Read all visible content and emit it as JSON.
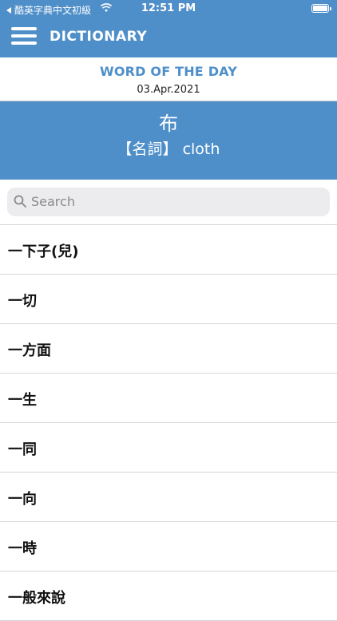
{
  "status_bar": {
    "back_app": "酷英字典中文初級",
    "time": "12:51 PM"
  },
  "nav": {
    "title": "DICTIONARY"
  },
  "word_of_the_day": {
    "heading": "WORD OF THE DAY",
    "date": "03.Apr.2021",
    "word": "布",
    "definition": "【名詞】 cloth"
  },
  "search": {
    "placeholder": "Search"
  },
  "entries": [
    "一下子(兒)",
    "一切",
    "一方面",
    "一生",
    "一同",
    "一向",
    "一時",
    "一般來說"
  ],
  "colors": {
    "accent": "#4f8fc9",
    "search_bg": "#ececee"
  },
  "icons": {
    "menu": "hamburger-icon",
    "search": "magnifier-icon",
    "wifi": "wifi-icon",
    "battery": "battery-icon"
  }
}
